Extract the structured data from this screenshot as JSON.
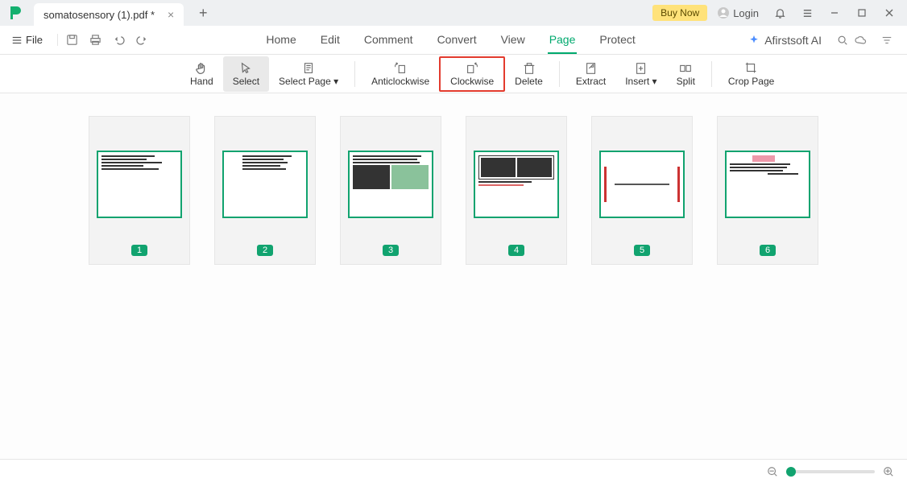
{
  "tab": {
    "title": "somatosensory (1).pdf *"
  },
  "header": {
    "buy": "Buy Now",
    "login": "Login"
  },
  "file": {
    "label": "File"
  },
  "menu": {
    "home": "Home",
    "edit": "Edit",
    "comment": "Comment",
    "convert": "Convert",
    "view": "View",
    "page": "Page",
    "protect": "Protect",
    "ai": "Afirstsoft AI"
  },
  "tools": {
    "hand": "Hand",
    "select": "Select",
    "selectpage": "Select Page",
    "anticlockwise": "Anticlockwise",
    "clockwise": "Clockwise",
    "delete": "Delete",
    "extract": "Extract",
    "insert": "Insert",
    "split": "Split",
    "crop": "Crop Page"
  },
  "pages": [
    "1",
    "2",
    "3",
    "4",
    "5",
    "6"
  ]
}
